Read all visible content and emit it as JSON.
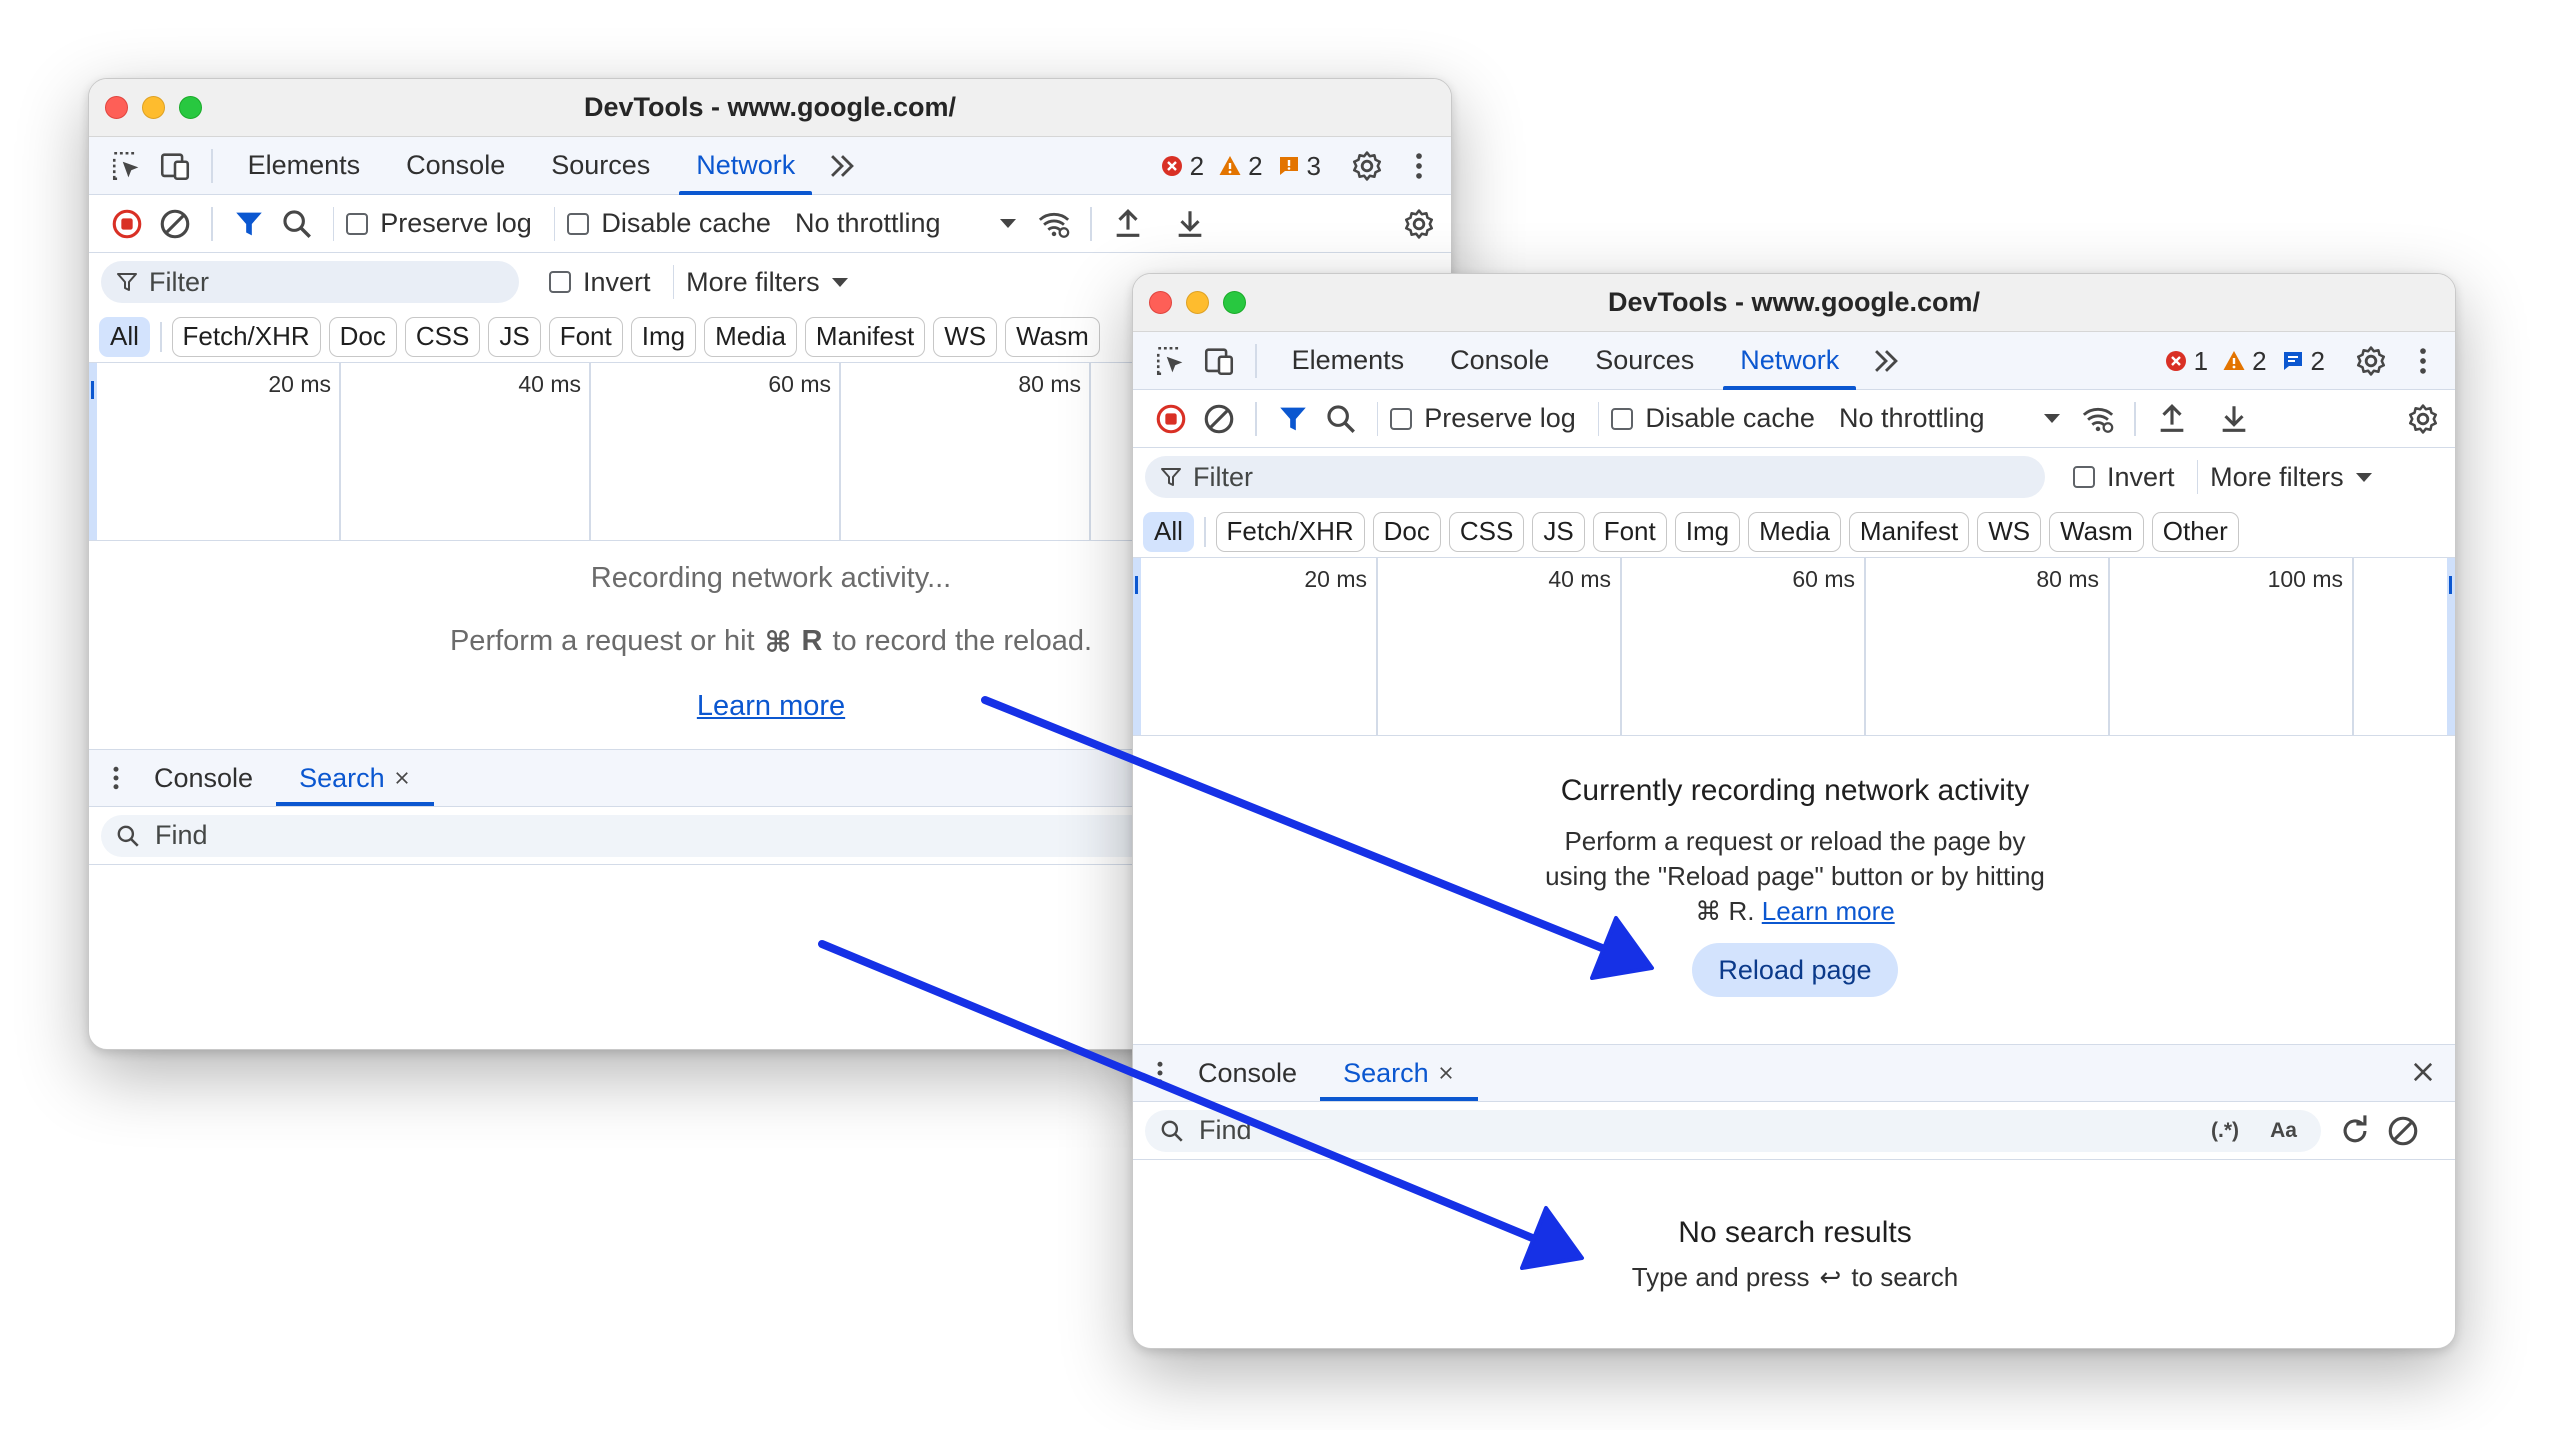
{
  "colors": {
    "accent": "#0b57d0",
    "arrow": "#1631e6",
    "error": "#d93025",
    "warning": "#e37400",
    "issue": "#f29900"
  },
  "back_window": {
    "title": "DevTools - www.google.com/",
    "tabs": [
      "Elements",
      "Console",
      "Sources",
      "Network"
    ],
    "active_tab": "Network",
    "badges": {
      "errors": "2",
      "warnings": "2",
      "issues": "3"
    },
    "toolbar": {
      "preserve_log": "Preserve log",
      "disable_cache": "Disable cache",
      "throttling": "No throttling"
    },
    "filter": {
      "placeholder": "Filter",
      "invert": "Invert",
      "more_filters": "More filters"
    },
    "types": [
      "All",
      "Fetch/XHR",
      "Doc",
      "CSS",
      "JS",
      "Font",
      "Img",
      "Media",
      "Manifest",
      "WS",
      "Wasm"
    ],
    "timeline": [
      "20 ms",
      "40 ms",
      "60 ms",
      "80 ms"
    ],
    "empty": {
      "line1": "Recording network activity...",
      "line2_before": "Perform a request or hit",
      "key_glyph": "⌘",
      "key": "R",
      "line2_after": "to record the reload.",
      "learn_more": "Learn more"
    },
    "drawer": {
      "tabs": [
        "Console",
        "Search"
      ],
      "find_placeholder": "Find"
    }
  },
  "front_window": {
    "title": "DevTools - www.google.com/",
    "tabs": [
      "Elements",
      "Console",
      "Sources",
      "Network"
    ],
    "active_tab": "Network",
    "badges": {
      "errors": "1",
      "warnings": "2",
      "issues": "2"
    },
    "toolbar": {
      "preserve_log": "Preserve log",
      "disable_cache": "Disable cache",
      "throttling": "No throttling"
    },
    "filter": {
      "placeholder": "Filter",
      "invert": "Invert",
      "more_filters": "More filters"
    },
    "types": [
      "All",
      "Fetch/XHR",
      "Doc",
      "CSS",
      "JS",
      "Font",
      "Img",
      "Media",
      "Manifest",
      "WS",
      "Wasm",
      "Other"
    ],
    "timeline": [
      "20 ms",
      "40 ms",
      "60 ms",
      "80 ms",
      "100 ms"
    ],
    "empty": {
      "heading": "Currently recording network activity",
      "line1": "Perform a request or reload the page by",
      "line2": "using the \"Reload page\" button or by hitting",
      "line3": "⌘ R.",
      "learn_more": "Learn more",
      "reload_button": "Reload page"
    },
    "drawer": {
      "tabs": [
        "Console",
        "Search"
      ],
      "find_placeholder": "Find",
      "regex": "(.*)",
      "match_case": "Aa",
      "no_results": "No search results",
      "hint_before": "Type and press",
      "enter_glyph": "↩",
      "hint_after": "to search"
    }
  }
}
